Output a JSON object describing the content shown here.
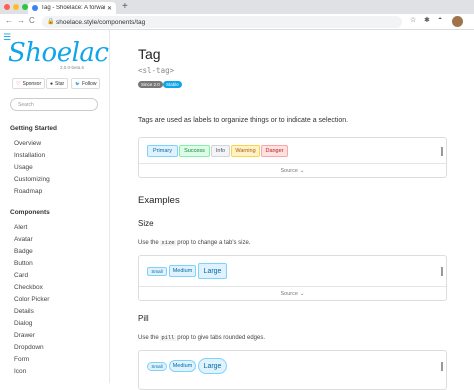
{
  "browser": {
    "tab_title": "Tag - Shoelace: A forward-thi",
    "new_tab": "+",
    "url": "shoelace.style/components/tag",
    "controls": {
      "back": "←",
      "forward": "→",
      "reload": "C"
    }
  },
  "sidebar": {
    "logo": "Shoelace",
    "version": "2.0.0-beta.6",
    "social": [
      {
        "icon": "heart-icon",
        "glyph": "♡",
        "label": "Sponsor"
      },
      {
        "icon": "github-icon",
        "glyph": "●",
        "label": "Star"
      },
      {
        "icon": "twitter-icon",
        "glyph": "🐦",
        "label": "Follow"
      }
    ],
    "search_placeholder": "Search",
    "sections": [
      {
        "title": "Getting Started",
        "items": [
          "Overview",
          "Installation",
          "Usage",
          "Customizing",
          "Roadmap"
        ]
      },
      {
        "title": "Components",
        "items": [
          "Alert",
          "Avatar",
          "Badge",
          "Button",
          "Card",
          "Checkbox",
          "Color Picker",
          "Details",
          "Dialog",
          "Drawer",
          "Dropdown",
          "Form",
          "Icon"
        ]
      }
    ]
  },
  "main": {
    "title": "Tag",
    "tag_name": "<sl-tag>",
    "badges": [
      {
        "label": "Since 2.0",
        "color": "#777777"
      },
      {
        "label": "Stable",
        "color": "#0ea5e9"
      }
    ],
    "intro": "Tags are used as labels to organize things or to indicate a selection.",
    "demo_tags": [
      {
        "label": "Primary",
        "bg": "#e0f2fe",
        "border": "#7dd3fc",
        "color": "#0369a1"
      },
      {
        "label": "Success",
        "bg": "#dcfce7",
        "border": "#86efac",
        "color": "#15803d"
      },
      {
        "label": "Info",
        "bg": "#f3f4f6",
        "border": "#d1d5db",
        "color": "#4b5563"
      },
      {
        "label": "Warning",
        "bg": "#fef3c7",
        "border": "#fcd34d",
        "color": "#b45309"
      },
      {
        "label": "Danger",
        "bg": "#fee2e2",
        "border": "#fca5a5",
        "color": "#b91c1c"
      }
    ],
    "source_label": "Source",
    "examples_heading": "Examples",
    "size": {
      "heading": "Size",
      "desc_pre": "Use the ",
      "desc_code": "size",
      "desc_post": " prop to change a tab's size.",
      "tags": [
        "Small",
        "Medium",
        "Large"
      ]
    },
    "pill": {
      "heading": "Pill",
      "desc_pre": "Use the ",
      "desc_code": "pill",
      "desc_post": " prop to give tabs rounded edges.",
      "tags": [
        "Small",
        "Medium",
        "Large"
      ]
    }
  }
}
